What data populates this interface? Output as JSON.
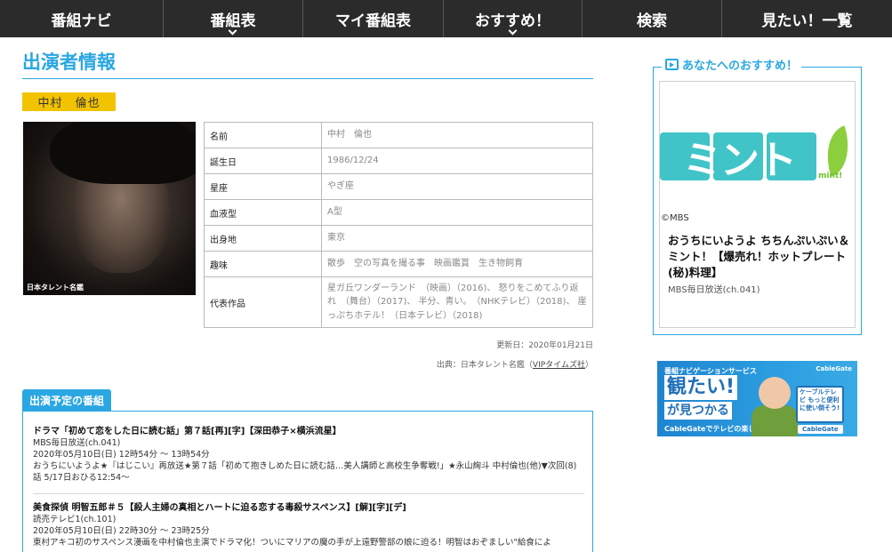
{
  "nav": [
    {
      "label": "番組ナビ",
      "dropdown": false
    },
    {
      "label": "番組表",
      "dropdown": true
    },
    {
      "label": "マイ番組表",
      "dropdown": false
    },
    {
      "label": "おすすめ！",
      "dropdown": true
    },
    {
      "label": "検索",
      "dropdown": false
    },
    {
      "label": "見たい！一覧",
      "dropdown": false
    }
  ],
  "page_title": "出演者情報",
  "performer_name": "中村　倫也",
  "photo_caption": "日本タレント名鑑",
  "profile": {
    "rows": [
      {
        "key": "名前",
        "value": "中村　倫也"
      },
      {
        "key": "誕生日",
        "value": "1986/12/24"
      },
      {
        "key": "星座",
        "value": "やぎ座"
      },
      {
        "key": "血液型",
        "value": "A型"
      },
      {
        "key": "出身地",
        "value": "東京"
      },
      {
        "key": "趣味",
        "value": "散歩　空の写真を撮る事　映画鑑賞　生き物飼育"
      },
      {
        "key": "代表作品",
        "value": "星ガ丘ワンダーランド　（映画）（2016)、 怒りをこめてふり返れ　（舞台）（2017)、 半分、青い。　（NHKテレビ）（2018)、 崖っぷちホテル！（日本テレビ）（2018)"
      }
    ]
  },
  "updated": "更新日：2020年01月21日",
  "source_prefix": "出典：日本タレント名鑑（",
  "source_link": "VIPタイムズ社",
  "source_suffix": "）",
  "schedule": {
    "tab": "出演予定の番組",
    "programs": [
      {
        "title": "ドラマ「初めて恋をした日に読む話」第７話[再][字]【深田恭子×横浜流星】",
        "channel": "MBS毎日放送(ch.041)",
        "time": "2020年05月10日(日) 12時54分 〜 13時54分",
        "desc": "おうちにいようよ★『はじこい』再放送★第７話「初めて抱きしめた日に読む話…美人講師と高校生争奪戦!」★永山絢斗 中村倫也(他)▼次回(8)話 5/17日おひる12:54〜"
      },
      {
        "title": "美食探偵 明智五郎＃５【殺人主婦の真相とハートに迫る恋する毒殺サスペンス】[解][字][デ]",
        "channel": "読売テレビ1(ch.101)",
        "time": "2020年05月10日(日) 22時30分 〜 23時25分",
        "desc": "東村アキコ初のサスペンス漫画を中村倫也主演でドラマ化！ついにマリアの魔の手が上遠野警部の娘に迫る！明智はおぞましい\"給食によ"
      }
    ]
  },
  "sidebar": {
    "rec_heading": "あなたへのおすすめ！",
    "rec_logo_text": "ミント",
    "rec_logo_sub": "mint!",
    "rec_copyright": "©MBS",
    "rec_title": "おうちにいようよ ちちんぷいぷい＆ミント！【爆売れ！ホットプレート(秘)料理】",
    "rec_channel": "MBS毎日放送(ch.041)",
    "banner": {
      "line1": "番組ナビゲーションサービス",
      "line2": "観たい!",
      "line3": "が見つかる",
      "line4": "CableGateでテレビの楽しさ再発見",
      "logo": "CableGate",
      "tv_text": "ケーブルテレビ もっと便利に使い倒そう!",
      "button": "CableGate"
    }
  },
  "colors": {
    "accent": "#2aa7e2",
    "nav_bg": "#2b2b2b",
    "name_tag": "#f2c300",
    "mint": "#40c4c8",
    "mint_leaf": "#8ccf3e"
  }
}
